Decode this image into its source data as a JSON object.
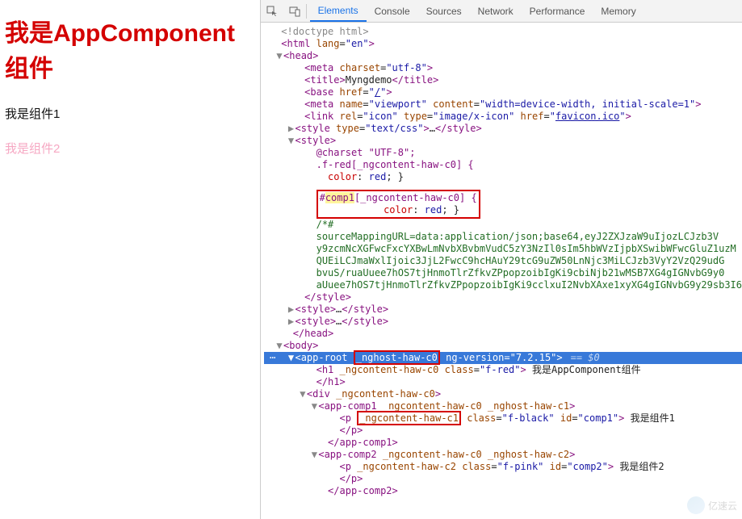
{
  "app": {
    "title": "我是AppComponent组件",
    "comp1": "我是组件1",
    "comp2": "我是组件2"
  },
  "devtools": {
    "tabs": [
      "Elements",
      "Console",
      "Sources",
      "Network",
      "Performance",
      "Memory"
    ],
    "activeTab": 0,
    "dom": {
      "doctype": "<!doctype html>",
      "htmlOpen": {
        "tag": "html",
        "attrs": [
          [
            "lang",
            "en"
          ]
        ]
      },
      "head": {
        "meta_charset": {
          "tag": "meta",
          "attrs": [
            [
              "charset",
              "utf-8"
            ]
          ]
        },
        "title": {
          "tag": "title",
          "text": "Myngdemo"
        },
        "base": {
          "tag": "base",
          "attrs": [
            [
              "href",
              "/"
            ]
          ]
        },
        "meta_viewport": {
          "tag": "meta",
          "attrs": [
            [
              "name",
              "viewport"
            ],
            [
              "content",
              "width=device-width, initial-scale=1"
            ]
          ]
        },
        "link_icon": {
          "tag": "link",
          "attrs": [
            [
              "rel",
              "icon"
            ],
            [
              "type",
              "image/x-icon"
            ]
          ],
          "href_link": "favicon.ico"
        },
        "style1": {
          "collapsed": "<style type=\"text/css\">…</style>"
        },
        "style2": {
          "open": "<style>",
          "rule_charset": "@charset \"UTF-8\";",
          "rule_fred_sel": ".f-red[_ngcontent-haw-c0] {",
          "rule_fred_prop": "color",
          "rule_fred_val": "red",
          "rule_comp_sel_prefix": "#",
          "rule_comp_sel_hl": "comp1",
          "rule_comp_sel_suffix": "[_ngcontent-haw-c0] {",
          "rule_comp_prop": "color",
          "rule_comp_val": "red",
          "comment_open": "/*#",
          "src1": "sourceMappingURL=data:application/json;base64,eyJ2ZXJzaW9uIjozLCJzb3V",
          "src2": "y9zcmNcXGFwcFxcYXBwLmNvbXBvbmVudC5zY3NzIl0sIm5hbWVzIjpbXSwibWFwcGluZ1uzM",
          "src3": "QUEiLCJmaWxlIjoic3JjL2FwcC9hcHAuY29tcG9uZW50LnNjc3MiLCJzb3VyY2VzQ29udG",
          "src4": "bvuS/ruaUuee7hOS7tjHnmoTlrZfkvZPpopzoibIgKi9cbiNjb21wMSB7XG4gIGNvbG9y0",
          "src5": "aUuee7hOS7tjHnmoTlrZfkvZPpopzoibIgKi9cclxuI2NvbXAxe1xyXG4gIGNvbG9y29sb3I6",
          "close": "</style>"
        },
        "style3": "<style>…</style>",
        "style4": "<style>…</style>",
        "headClose": "</head>"
      },
      "body": {
        "open": "<body>",
        "approot": {
          "open_a": "<app-root ",
          "host_attr": "_nghost-haw-c0",
          "open_b": " ng-version=\"7.2.15\">",
          "eq": "== $0",
          "h1": {
            "open": "<h1 _ngcontent-haw-c0 class=\"f-red\">",
            "text": " 我是AppComponent组件",
            "close": "</h1>"
          },
          "div": {
            "open": "<div _ngcontent-haw-c0>",
            "appcomp1": {
              "open": "<app-comp1 _ngcontent-haw-c0 _nghost-haw-c1>",
              "p_a": "<p ",
              "p_hl": "_ngcontent-haw-c1",
              "p_b": " class=\"f-black\" id=\"comp1\">",
              "p_text": " 我是组件1",
              "p_close": "</p>",
              "close": "</app-comp1>"
            },
            "appcomp2": {
              "open": "<app-comp2 _ngcontent-haw-c0 _nghost-haw-c2>",
              "p": "<p _ngcontent-haw-c2 class=\"f-pink\" id=\"comp2\">",
              "p_text": " 我是组件2",
              "p_close": "</p>",
              "close": "</app-comp2>"
            }
          }
        }
      }
    }
  },
  "watermark": "亿速云"
}
